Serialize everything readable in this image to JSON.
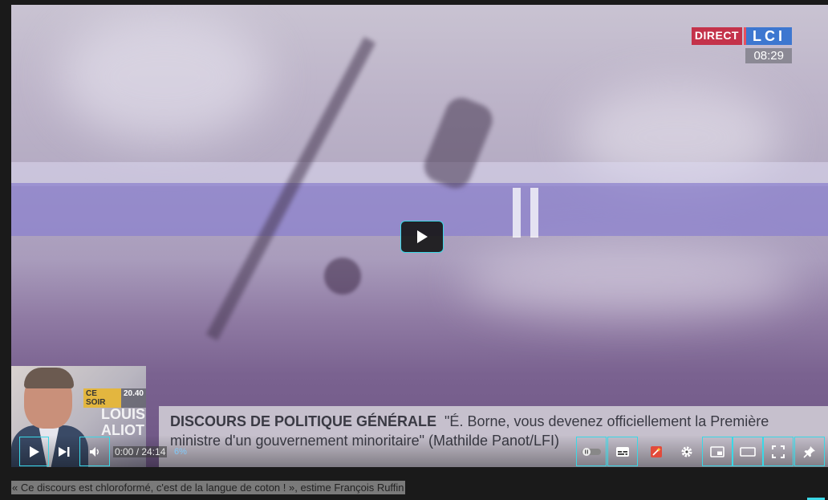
{
  "overlay": {
    "logo_direct": "DIRECT",
    "logo_channel": "LCI",
    "clock": "08:29"
  },
  "thumbnail": {
    "tag_label": "CE SOIR",
    "tag_time": "20.40",
    "guest_first": "LOUIS",
    "guest_last": "ALIOT"
  },
  "caption": {
    "topic": "DISCOURS DE POLITIQUE GÉNÉRALE",
    "quote": "\"É. Borne, vous devenez officiellement la Première ministre d'un gouvernement minoritaire\" (Mathilde Panot/LFI)"
  },
  "player": {
    "time": "0:00 / 24:14",
    "buffer_percent": "6%",
    "progress": 0,
    "accent_color": "#3ad8e6",
    "buttons": [
      "play-icon",
      "next-icon",
      "volume-icon",
      "autoplay-toggle-icon",
      "subtitles-icon",
      "sparkle-icon",
      "gear-icon",
      "miniplayer-icon",
      "theater-icon",
      "fullscreen-icon",
      "pin-icon"
    ]
  },
  "video_title": "« Ce discours est chloroformé, c'est de la langue de coton ! », estime François Ruffin"
}
